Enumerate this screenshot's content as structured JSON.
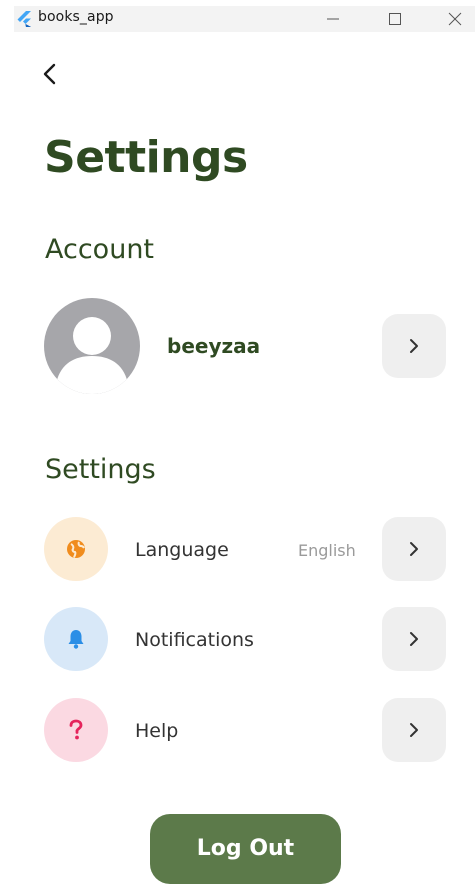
{
  "window": {
    "title": "books_app",
    "controls": [
      "minimize-icon",
      "maximize-icon",
      "close-icon"
    ]
  },
  "header": {
    "back_icon": "chevron-left-icon",
    "title": "Settings"
  },
  "account": {
    "section_title": "Account",
    "avatar_icon": "default-avatar-icon",
    "username": "beeyzaa",
    "chevron_icon": "chevron-right-icon"
  },
  "settings": {
    "section_title": "Settings",
    "items": [
      {
        "label": "Language",
        "value": "English",
        "icon": "globe-icon",
        "icon_color": "#f08c1d",
        "icon_bg": "#fcebd3"
      },
      {
        "label": "Notifications",
        "value": "",
        "icon": "bell-icon",
        "icon_color": "#2b8ee6",
        "icon_bg": "#d8e8f8"
      },
      {
        "label": "Help",
        "value": "",
        "icon": "question-icon",
        "icon_color": "#e5245c",
        "icon_bg": "#fbd9e2"
      }
    ]
  },
  "actions": {
    "logout_label": "Log Out"
  },
  "colors": {
    "primary_text": "#2f4a22",
    "button_green": "#5c7a4a",
    "chevron_bg": "#efefef"
  }
}
